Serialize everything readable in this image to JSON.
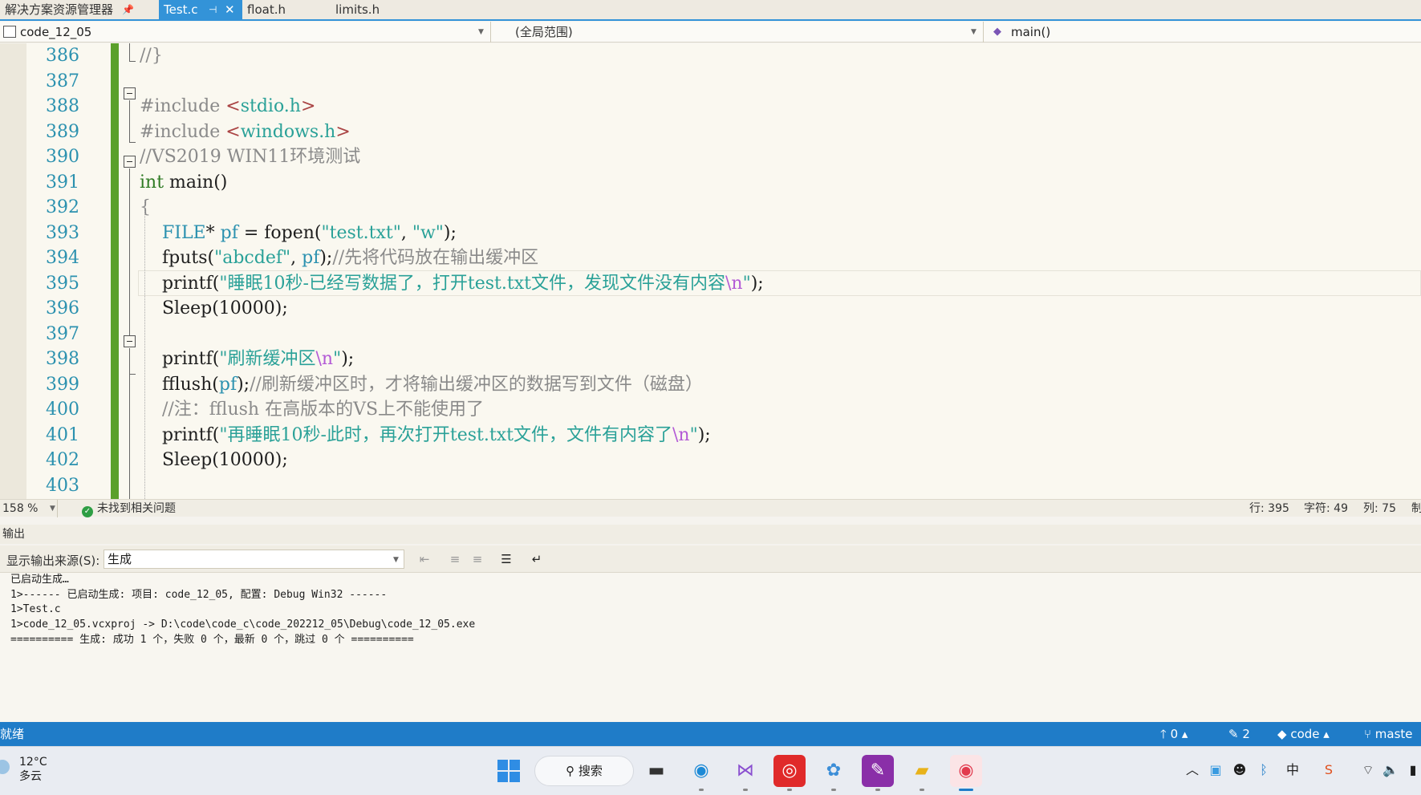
{
  "tabs": {
    "solution_explorer": "解决方案资源管理器",
    "pin_icon": "pin-icon",
    "active": "Test.c",
    "others": [
      "float.h",
      "limits.h"
    ]
  },
  "nav": {
    "project": "code_12_05",
    "scope": "(全局范围)",
    "function": "main()"
  },
  "editor": {
    "current_line": 395,
    "lines": [
      {
        "n": "386",
        "segs": [
          {
            "t": "//}",
            "c": "c-cmt"
          }
        ]
      },
      {
        "n": "387",
        "segs": []
      },
      {
        "n": "388",
        "segs": [
          {
            "t": "#include ",
            "c": "c-cmt"
          },
          {
            "t": "<",
            "c": "c-angle"
          },
          {
            "t": "stdio.h",
            "c": "c-hdr"
          },
          {
            "t": ">",
            "c": "c-angle"
          }
        ]
      },
      {
        "n": "389",
        "segs": [
          {
            "t": "#include ",
            "c": "c-cmt"
          },
          {
            "t": "<",
            "c": "c-angle"
          },
          {
            "t": "windows.h",
            "c": "c-hdr"
          },
          {
            "t": ">",
            "c": "c-angle"
          }
        ]
      },
      {
        "n": "390",
        "segs": [
          {
            "t": "//VS2019 WIN11环境测试",
            "c": "c-cmt"
          }
        ]
      },
      {
        "n": "391",
        "segs": [
          {
            "t": "int",
            "c": "c-kw"
          },
          {
            "t": " main()",
            "c": ""
          }
        ]
      },
      {
        "n": "392",
        "segs": [
          {
            "t": "{",
            "c": "c-cmt"
          }
        ]
      },
      {
        "n": "393",
        "segs": [
          {
            "t": "    ",
            "c": ""
          },
          {
            "t": "FILE",
            "c": "c-type"
          },
          {
            "t": "* ",
            "c": ""
          },
          {
            "t": "pf",
            "c": "c-type"
          },
          {
            "t": " = fopen(",
            "c": ""
          },
          {
            "t": "\"test.txt\"",
            "c": "c-str"
          },
          {
            "t": ", ",
            "c": ""
          },
          {
            "t": "\"w\"",
            "c": "c-str"
          },
          {
            "t": ");",
            "c": ""
          }
        ]
      },
      {
        "n": "394",
        "segs": [
          {
            "t": "    fputs(",
            "c": ""
          },
          {
            "t": "\"abcdef\"",
            "c": "c-str"
          },
          {
            "t": ", ",
            "c": ""
          },
          {
            "t": "pf",
            "c": "c-type"
          },
          {
            "t": ");",
            "c": ""
          },
          {
            "t": "//先将代码放在输出缓冲区",
            "c": "c-cmt"
          }
        ]
      },
      {
        "n": "395",
        "segs": [
          {
            "t": "    printf(",
            "c": ""
          },
          {
            "t": "\"睡眠10秒-已经写数据了，打开test.txt文件，发现文件没有内容",
            "c": "c-str"
          },
          {
            "t": "\\n",
            "c": "c-esc"
          },
          {
            "t": "\"",
            "c": "c-str"
          },
          {
            "t": ");",
            "c": ""
          }
        ]
      },
      {
        "n": "396",
        "segs": [
          {
            "t": "    Sleep(10000);",
            "c": ""
          }
        ]
      },
      {
        "n": "397",
        "segs": []
      },
      {
        "n": "398",
        "segs": [
          {
            "t": "    printf(",
            "c": ""
          },
          {
            "t": "\"刷新缓冲区",
            "c": "c-str"
          },
          {
            "t": "\\n",
            "c": "c-esc"
          },
          {
            "t": "\"",
            "c": "c-str"
          },
          {
            "t": ");",
            "c": ""
          }
        ]
      },
      {
        "n": "399",
        "segs": [
          {
            "t": "    fflush(",
            "c": ""
          },
          {
            "t": "pf",
            "c": "c-type"
          },
          {
            "t": ");",
            "c": ""
          },
          {
            "t": "//刷新缓冲区时，才将输出缓冲区的数据写到文件（磁盘）",
            "c": "c-cmt"
          }
        ]
      },
      {
        "n": "400",
        "segs": [
          {
            "t": "    //注：fflush 在高版本的VS上不能使用了",
            "c": "c-cmt"
          }
        ]
      },
      {
        "n": "401",
        "segs": [
          {
            "t": "    printf(",
            "c": ""
          },
          {
            "t": "\"再睡眠10秒-此时，再次打开test.txt文件，文件有内容了",
            "c": "c-str"
          },
          {
            "t": "\\n",
            "c": "c-esc"
          },
          {
            "t": "\"",
            "c": "c-str"
          },
          {
            "t": ");",
            "c": ""
          }
        ]
      },
      {
        "n": "402",
        "segs": [
          {
            "t": "    Sleep(10000);",
            "c": ""
          }
        ]
      },
      {
        "n": "403",
        "segs": []
      }
    ]
  },
  "edstatus": {
    "zoom": "158 %",
    "issues": "未找到相关问题",
    "line": "行: 395",
    "char": "字符: 49",
    "col": "列: 75",
    "mode": "制"
  },
  "output": {
    "title": "输出",
    "source_label": "显示输出来源(S):",
    "source_value": "生成",
    "lines": [
      "已启动生成…",
      "1>------ 已启动生成: 项目: code_12_05, 配置: Debug Win32 ------",
      "1>Test.c",
      "1>code_12_05.vcxproj -> D:\\code\\code_c\\code_202212_05\\Debug\\code_12_05.exe",
      "========== 生成: 成功 1 个，失败 0 个，最新 0 个，跳过 0 个 =========="
    ]
  },
  "statusbar": {
    "ready": "就绪",
    "up_count": "0",
    "pen_count": "2",
    "repo": "code",
    "branch": "maste"
  },
  "taskbar": {
    "temp": "12°C",
    "weather": "多云",
    "search": "搜索",
    "apps": [
      "start-icon",
      "search-icon",
      "terminal-icon",
      "edge-icon",
      "visual-studio-icon",
      "netease-music-icon",
      "chrome-like-icon",
      "onenote-icon",
      "file-explorer-icon",
      "recorder-icon"
    ]
  }
}
